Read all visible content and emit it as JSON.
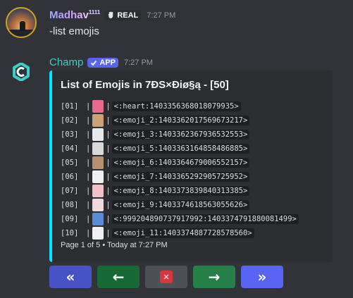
{
  "message1": {
    "username": "Madhav",
    "username_sup": "1111",
    "tag_label": "REAL",
    "timestamp": "7:27 PM",
    "content": "-list emojis"
  },
  "message2": {
    "username": "Champ",
    "tag_label": "APP",
    "timestamp": "7:27 PM"
  },
  "embed": {
    "accent_color": "#00e5ff",
    "title": "List of Emojis in 7ÐS×Ðiø§ą - [50]",
    "rows": [
      {
        "index": "[01]",
        "code": "<:heart:1403356368018079935>",
        "thumb": "#e86a8a"
      },
      {
        "index": "[02]",
        "code": "<:emoji_2:1403362017569673217>",
        "thumb": "#c9a27a"
      },
      {
        "index": "[03]",
        "code": "<:emoji_3:1403362367936532553>",
        "thumb": "#e8e8e8"
      },
      {
        "index": "[04]",
        "code": "<:emoji_5:1403363164858486885>",
        "thumb": "#d8d8d8"
      },
      {
        "index": "[05]",
        "code": "<:emoji_6:1403364679006552157>",
        "thumb": "#b89070"
      },
      {
        "index": "[06]",
        "code": "<:emoji_7:1403365292905725952>",
        "thumb": "#f0f0f0"
      },
      {
        "index": "[07]",
        "code": "<:emoji_8:1403373839840313385>",
        "thumb": "#f4c0c8"
      },
      {
        "index": "[08]",
        "code": "<:emoji_9:1403374618563055626>",
        "thumb": "#f0d8e0"
      },
      {
        "index": "[09]",
        "code": "<:999204890737917992:1403374791880081499>",
        "thumb": "#5a8ad8"
      },
      {
        "index": "[10]",
        "code": "<:emoji_11:1403374887728578560>",
        "thumb": "#f0f0f0"
      }
    ],
    "footer": "Page 1 of 5 • Today at 7:27 PM"
  },
  "buttons": [
    {
      "name": "first-page-button",
      "icon": "double-chevron-left-icon",
      "glyph": "«",
      "color": "navy"
    },
    {
      "name": "previous-page-button",
      "icon": "arrow-left-icon",
      "glyph": "←",
      "color": "dkgreen"
    },
    {
      "name": "close-button",
      "icon": "close-icon",
      "glyph": "✕",
      "color": "grey"
    },
    {
      "name": "next-page-button",
      "icon": "arrow-right-icon",
      "glyph": "→",
      "color": "green"
    },
    {
      "name": "last-page-button",
      "icon": "double-chevron-right-icon",
      "glyph": "»",
      "color": "blurple"
    }
  ]
}
